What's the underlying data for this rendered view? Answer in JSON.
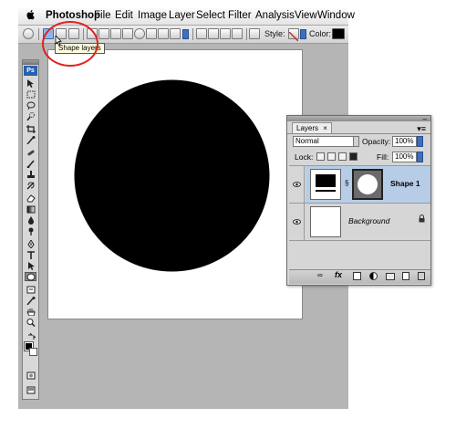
{
  "menubar": {
    "apple": "",
    "app_name": "Photoshop",
    "items": [
      "File",
      "Edit",
      "Image",
      "Layer",
      "Select",
      "Filter",
      "Analysis",
      "View",
      "Window"
    ]
  },
  "options_bar": {
    "style_label": "Style:",
    "color_label": "Color:",
    "color_value": "#000000"
  },
  "tooltip": {
    "text": "Shape layers"
  },
  "annotation": {
    "color": "#e0221f"
  },
  "tools_panel": {
    "logo": "Ps",
    "foreground_color": "#000000",
    "background_color": "#ffffff",
    "tools": [
      "move-tool-icon",
      "marquee-tool-icon",
      "lasso-tool-icon",
      "quick-selection-icon",
      "crop-tool-icon",
      "eyedropper-tool-icon",
      "healing-brush-icon",
      "brush-tool-icon",
      "clone-stamp-icon",
      "history-brush-icon",
      "eraser-tool-icon",
      "gradient-tool-icon",
      "blur-tool-icon",
      "dodge-tool-icon",
      "pen-tool-icon",
      "type-tool-icon",
      "path-selection-icon",
      "ellipse-tool-icon",
      "notes-tool-icon",
      "eyedropper-2-icon",
      "hand-tool-icon",
      "zoom-tool-icon"
    ]
  },
  "canvas": {
    "background": "#ffffff",
    "shape": "ellipse",
    "shape_color": "#000000"
  },
  "layers_panel": {
    "tab_title": "Layers",
    "tab_close": "×",
    "blend_mode": "Normal",
    "opacity_label": "Opacity:",
    "opacity_value": "100%",
    "lock_label": "Lock:",
    "fill_label": "Fill:",
    "fill_value": "100%",
    "layers": [
      {
        "name": "Shape 1",
        "selected": true,
        "italic": false
      },
      {
        "name": "Background",
        "selected": false,
        "italic": true
      }
    ],
    "selected_color": "#b7cde7"
  }
}
